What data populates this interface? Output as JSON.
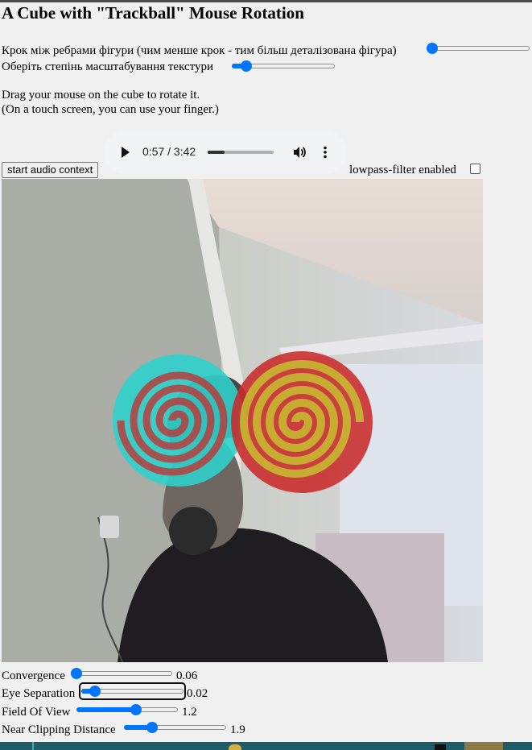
{
  "page": {
    "title": "A Cube with \"Trackball\" Mouse Rotation",
    "step_label": "Крок між ребрами фігури (чим менше крок - тим більш деталізована фігура)",
    "step_slider_fraction": 0.0,
    "scale_label": "Оберіть степінь масштабування текстури",
    "scale_slider_fraction": 0.1,
    "instructions_line1": "Drag your mouse on the cube to rotate it.",
    "instructions_line2": "(On a touch screen, you can use your finger.)"
  },
  "audio_player": {
    "time_display": "0:57 / 3:42",
    "progress_fraction": 0.257,
    "play_icon": "play-icon",
    "volume_icon": "volume-icon",
    "more_icon": "more-vert-icon"
  },
  "controls": {
    "start_audio_label": "start audio context",
    "lowpass_label": "lowpass-filter enabled",
    "lowpass_checked": false
  },
  "stereo": {
    "convergence_label": "Convergence",
    "convergence_value": "0.06",
    "convergence_fraction": 0.0,
    "eye_separation_label": "Eye Separation",
    "eye_separation_value": "0.02",
    "eye_separation_fraction": 0.09,
    "fov_label": "Field Of View",
    "fov_value": "1.2",
    "fov_fraction": 0.6,
    "near_label": "Near Clipping Distance",
    "near_value": "1.9",
    "near_fraction": 0.25
  },
  "colors": {
    "accent": "#0075ff",
    "cyan_sphere": "#2fd0cc",
    "red_sphere": "#c92a2a",
    "yellow_spiral": "#c8c030"
  }
}
